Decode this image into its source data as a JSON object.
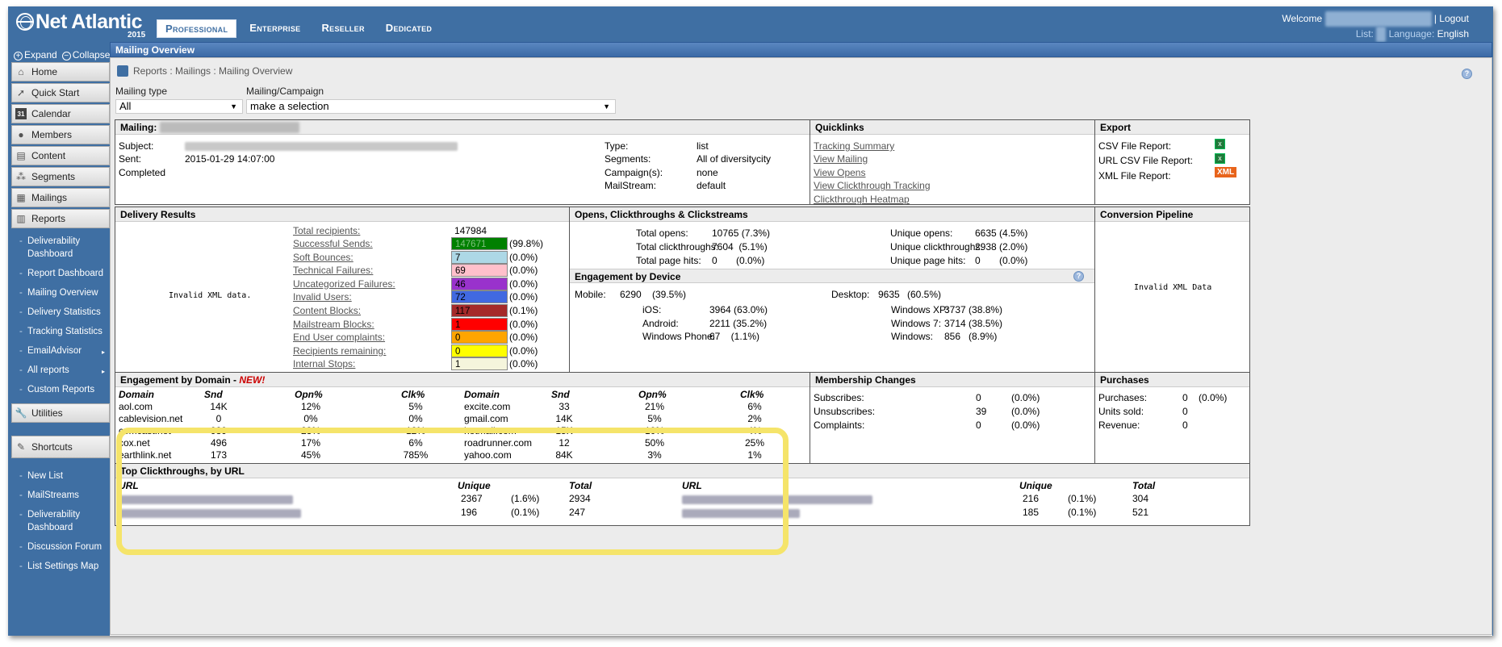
{
  "brand": {
    "name": "Net Atlantic",
    "year": "2015"
  },
  "top_nav": [
    "Professional",
    "Enterprise",
    "Reseller",
    "Dedicated"
  ],
  "header": {
    "welcome": "Welcome",
    "logout": "Logout",
    "list": "List:",
    "language_label": "Language:",
    "language": "English"
  },
  "sidebar": {
    "expand": "Expand",
    "collapse": "Collapse",
    "items": [
      {
        "label": "Home",
        "icon": "home-icon"
      },
      {
        "label": "Quick Start",
        "icon": "cursor-icon"
      },
      {
        "label": "Calendar",
        "icon": "calendar-icon"
      },
      {
        "label": "Members",
        "icon": "person-icon"
      },
      {
        "label": "Content",
        "icon": "document-icon"
      },
      {
        "label": "Segments",
        "icon": "segments-icon"
      },
      {
        "label": "Mailings",
        "icon": "mail-icon"
      },
      {
        "label": "Reports",
        "icon": "reports-icon"
      }
    ],
    "report_subitems": [
      "Deliverability Dashboard",
      "Report Dashboard",
      "Mailing Overview",
      "Delivery Statistics",
      "Tracking Statistics",
      "EmailAdvisor",
      "All reports",
      "Custom Reports"
    ],
    "utilities": "Utilities",
    "shortcuts": "Shortcuts",
    "shortcut_items": [
      "New List",
      "MailStreams",
      "Deliverability Dashboard",
      "Discussion Forum",
      "List Settings Map"
    ]
  },
  "page_title": "Mailing Overview",
  "breadcrumb": "Reports : Mailings : Mailing Overview",
  "filters": {
    "mailing_type_label": "Mailing type",
    "mailing_type_value": "All",
    "campaign_label": "Mailing/Campaign",
    "campaign_value": "make a selection"
  },
  "mailing": {
    "header": "Mailing:",
    "subject_label": "Subject:",
    "sent_label": "Sent:",
    "sent": "2015-01-29 14:07:00",
    "status": "Completed",
    "type_label": "Type:",
    "type": "list",
    "segments_label": "Segments:",
    "segments": "All of diversitycity",
    "campaigns_label": "Campaign(s):",
    "campaigns": "none",
    "mailstream_label": "MailStream:",
    "mailstream": "default"
  },
  "quicklinks": {
    "title": "Quicklinks",
    "links": [
      "Tracking Summary",
      "View Mailing",
      "View Opens",
      "View Clickthrough Tracking",
      "Clickthrough Heatmap"
    ]
  },
  "export": {
    "title": "Export",
    "items": [
      {
        "label": "CSV File Report:",
        "icon": "excel-icon"
      },
      {
        "label": "URL CSV File Report:",
        "icon": "excel-icon"
      },
      {
        "label": "XML File Report:",
        "icon": "xml-icon",
        "badge": "XML"
      }
    ]
  },
  "delivery": {
    "title": "Delivery Results",
    "chart_msg": "Invalid XML data.",
    "total_label": "Total recipients:",
    "total": "147984",
    "rows": [
      {
        "label": "Successful Sends:",
        "value": "147671",
        "pct": "(99.8%)",
        "color": "#008000",
        "text": "#7fbf7f"
      },
      {
        "label": "Soft Bounces:",
        "value": "7",
        "pct": "(0.0%)",
        "color": "#add8e6",
        "text": "#000"
      },
      {
        "label": "Technical Failures:",
        "value": "69",
        "pct": "(0.0%)",
        "color": "#ffc0cb",
        "text": "#000"
      },
      {
        "label": "Uncategorized Failures:",
        "value": "46",
        "pct": "(0.0%)",
        "color": "#9932cc",
        "text": "#000"
      },
      {
        "label": "Invalid Users:",
        "value": "72",
        "pct": "(0.0%)",
        "color": "#4169e1",
        "text": "#000"
      },
      {
        "label": "Content Blocks:",
        "value": "117",
        "pct": "(0.1%)",
        "color": "#a52a2a",
        "text": "#000"
      },
      {
        "label": "Mailstream Blocks:",
        "value": "1",
        "pct": "(0.0%)",
        "color": "#ff0000",
        "text": "#000"
      },
      {
        "label": "End User complaints:",
        "value": "0",
        "pct": "(0.0%)",
        "color": "#ffa500",
        "text": "#000"
      },
      {
        "label": "Recipients remaining:",
        "value": "0",
        "pct": "(0.0%)",
        "color": "#ffff00",
        "text": "#000"
      },
      {
        "label": "Internal Stops:",
        "value": "1",
        "pct": "(0.0%)",
        "color": "#f5f5dc",
        "text": "#000"
      }
    ]
  },
  "opens": {
    "title": "Opens, Clickthroughs & Clickstreams",
    "left": [
      {
        "label": "Total opens:",
        "value": "10765 (7.3%)"
      },
      {
        "label": "Total clickthroughs:",
        "value": "7604  (5.1%)"
      },
      {
        "label": "Total page hits:",
        "value": "0       (0.0%)"
      }
    ],
    "right": [
      {
        "label": "Unique opens:",
        "value": "6635 (4.5%)"
      },
      {
        "label": "Unique clickthroughs:",
        "value": "2938 (2.0%)"
      },
      {
        "label": "Unique page hits:",
        "value": "0       (0.0%)"
      }
    ]
  },
  "device": {
    "title": "Engagement by Device",
    "mobile_label": "Mobile:",
    "mobile": "6290",
    "mobile_pct": "(39.5%)",
    "desktop_label": "Desktop:",
    "desktop": "9635",
    "desktop_pct": "(60.5%)",
    "mobile_rows": [
      {
        "label": "iOS:",
        "value": "3964 (63.0%)"
      },
      {
        "label": "Android:",
        "value": "2211 (35.2%)"
      },
      {
        "label": "Windows Phone:",
        "value": "67    (1.1%)"
      }
    ],
    "desktop_rows": [
      {
        "label": "Windows XP:",
        "value": "3737 (38.8%)"
      },
      {
        "label": "Windows 7:",
        "value": "3714 (38.5%)"
      },
      {
        "label": "Windows:",
        "value": "856   (8.9%)"
      }
    ]
  },
  "conversion": {
    "title": "Conversion Pipeline",
    "msg": "Invalid XML Data"
  },
  "domain": {
    "title": "Engagement by Domain - ",
    "new": "NEW!",
    "headers": [
      "Domain",
      "Snd",
      "Opn%",
      "Clk%",
      "Domain",
      "Snd",
      "Opn%",
      "Clk%"
    ],
    "rows": [
      [
        "aol.com",
        "14K",
        "12%",
        "5%",
        "excite.com",
        "33",
        "21%",
        "6%"
      ],
      [
        "cablevision.net",
        "0",
        "0%",
        "0%",
        "gmail.com",
        "14K",
        "5%",
        "2%"
      ],
      [
        "comcast.net",
        "989",
        "23%",
        "12%",
        "hotmail.com",
        "15K",
        "10%",
        "4%"
      ],
      [
        "cox.net",
        "496",
        "17%",
        "6%",
        "roadrunner.com",
        "12",
        "50%",
        "25%"
      ],
      [
        "earthlink.net",
        "173",
        "45%",
        "785%",
        "yahoo.com",
        "84K",
        "3%",
        "1%"
      ]
    ]
  },
  "membership": {
    "title": "Membership Changes",
    "rows": [
      {
        "label": "Subscribes:",
        "value": "0",
        "pct": "(0.0%)"
      },
      {
        "label": "Unsubscribes:",
        "value": "39",
        "pct": "(0.0%)"
      },
      {
        "label": "Complaints:",
        "value": "0",
        "pct": "(0.0%)"
      }
    ]
  },
  "purchases": {
    "title": "Purchases",
    "rows": [
      {
        "label": "Purchases:",
        "value": "0    (0.0%)"
      },
      {
        "label": "Units sold:",
        "value": "0"
      },
      {
        "label": "Revenue:",
        "value": "0"
      }
    ]
  },
  "clickthroughs": {
    "title": "Top Clickthroughs, by URL",
    "headers": [
      "URL",
      "Unique",
      "Total",
      "URL",
      "Unique",
      "Total"
    ],
    "left_rows": [
      {
        "unique": "2367",
        "pct": "(1.6%)",
        "total": "2934"
      },
      {
        "unique": "196",
        "pct": "(0.1%)",
        "total": "247"
      }
    ],
    "right_rows": [
      {
        "unique": "216",
        "pct": "(0.1%)",
        "total": "304"
      },
      {
        "unique": "185",
        "pct": "(0.1%)",
        "total": "521"
      }
    ]
  }
}
